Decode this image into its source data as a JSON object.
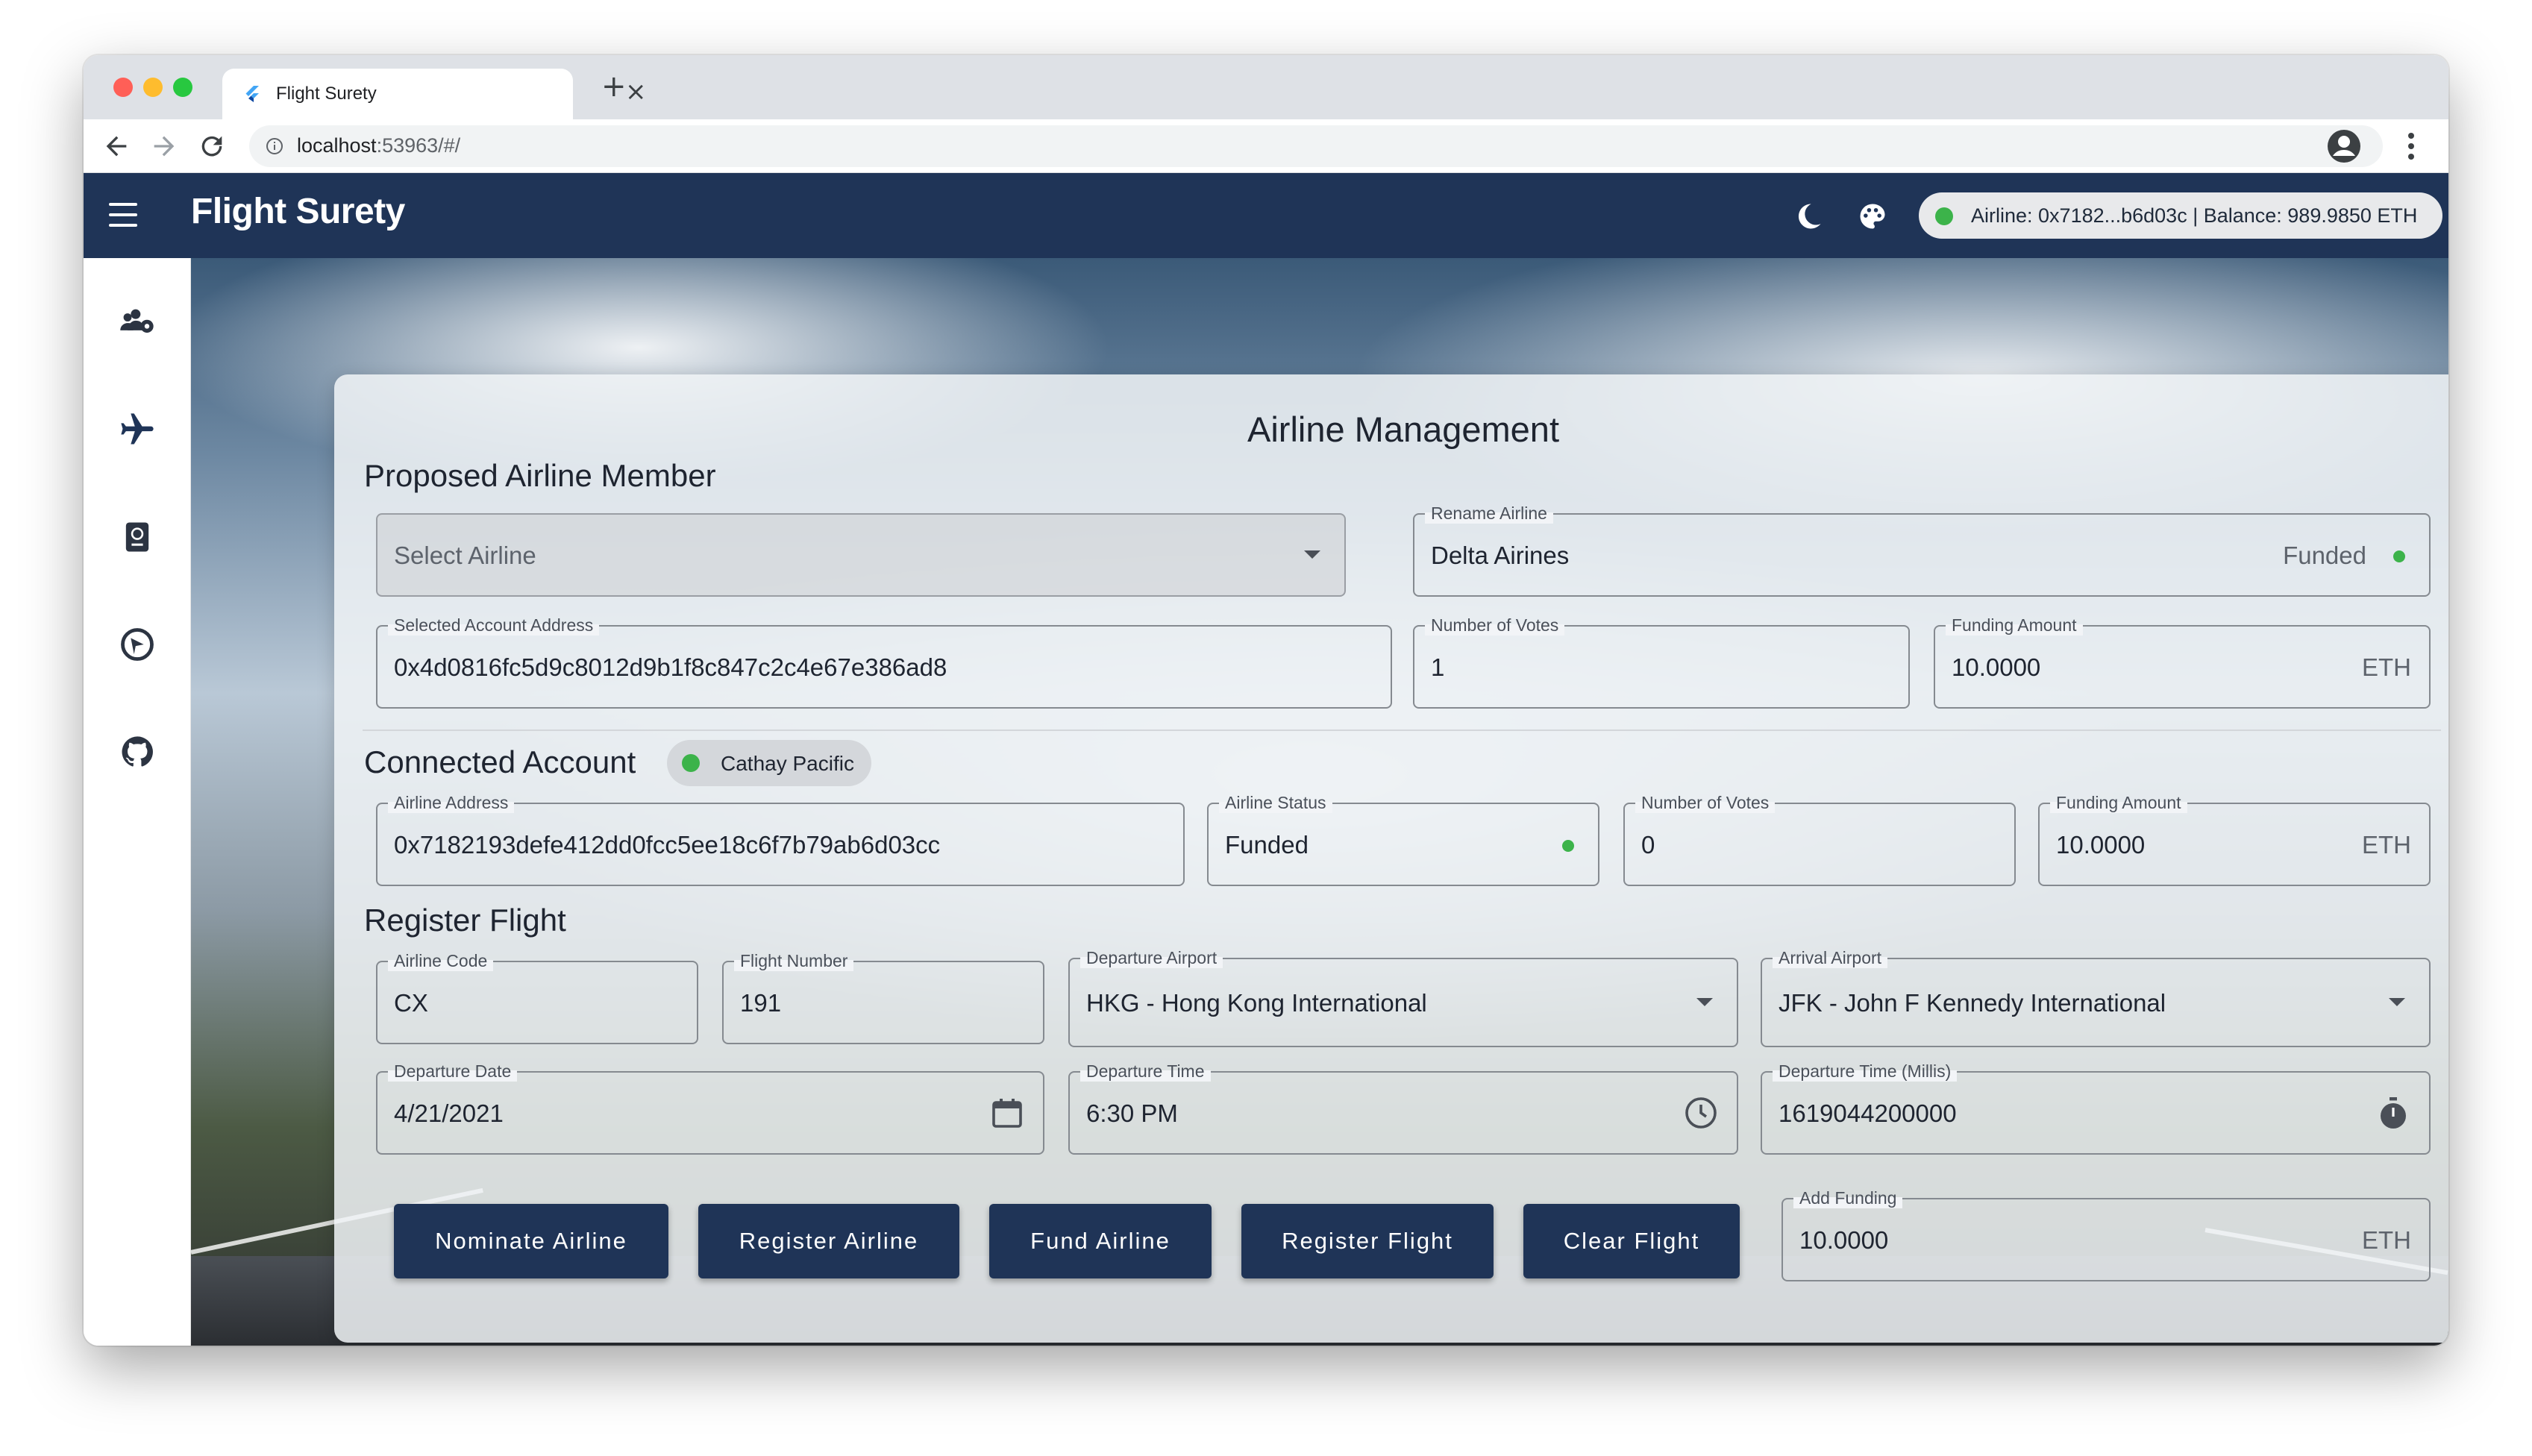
{
  "browser": {
    "tab_title": "Flight Surety",
    "new_tab": "+",
    "close": "×",
    "url_host": "localhost",
    "url_rest": ":53963/#/"
  },
  "app": {
    "title": "Flight Surety",
    "wallet": "Airline: 0x7182...b6d03c | Balance: 989.9850 ETH"
  },
  "card": {
    "title": "Airline Management",
    "proposed": {
      "section": "Proposed Airline Member",
      "select_placeholder": "Select Airline",
      "rename_label": "Rename Airline",
      "rename_value": "Delta Airines",
      "rename_status": "Funded",
      "address_label": "Selected Account Address",
      "address_value": "0x4d0816fc5d9c8012d9b1f8c847c2c4e67e386ad8",
      "votes_label": "Number of Votes",
      "votes_value": "1",
      "funding_label": "Funding Amount",
      "funding_value": "10.0000",
      "funding_unit": "ETH"
    },
    "connected": {
      "section": "Connected Account",
      "chip": "Cathay Pacific",
      "address_label": "Airline Address",
      "address_value": "0x7182193defe412dd0fcc5ee18c6f7b79ab6d03cc",
      "status_label": "Airline Status",
      "status_value": "Funded",
      "votes_label": "Number of Votes",
      "votes_value": "0",
      "funding_label": "Funding Amount",
      "funding_value": "10.0000",
      "funding_unit": "ETH"
    },
    "flight": {
      "section": "Register Flight",
      "code_label": "Airline Code",
      "code_value": "CX",
      "number_label": "Flight Number",
      "number_value": "191",
      "departure_label": "Departure Airport",
      "departure_value": "HKG - Hong Kong International",
      "arrival_label": "Arrival Airport",
      "arrival_value": "JFK - John F Kennedy International",
      "date_label": "Departure Date",
      "date_value": "4/21/2021",
      "time_label": "Departure Time",
      "time_value": "6:30 PM",
      "millis_label": "Departure Time (Millis)",
      "millis_value": "1619044200000"
    },
    "buttons": {
      "nominate": "Nominate Airline",
      "register_airline": "Register Airline",
      "fund": "Fund Airline",
      "register_flight": "Register Flight",
      "clear": "Clear Flight"
    },
    "add_funding": {
      "label": "Add Funding",
      "value": "10.0000",
      "unit": "ETH"
    }
  },
  "colors": {
    "appbar": "#1f3457",
    "accent": "#1f3457",
    "status_green": "#3cb34a"
  },
  "icons": [
    "flutter-icon",
    "back-icon",
    "forward-icon",
    "reload-icon",
    "info-icon",
    "star-icon",
    "profile-icon",
    "kebab-icon",
    "menu-icon",
    "dark-mode-icon",
    "palette-icon",
    "group-settings-icon",
    "airplane-icon",
    "passport-icon",
    "oracle-icon",
    "github-icon",
    "calendar-icon",
    "clock-icon",
    "stopwatch-icon",
    "dropdown-arrow-icon"
  ]
}
